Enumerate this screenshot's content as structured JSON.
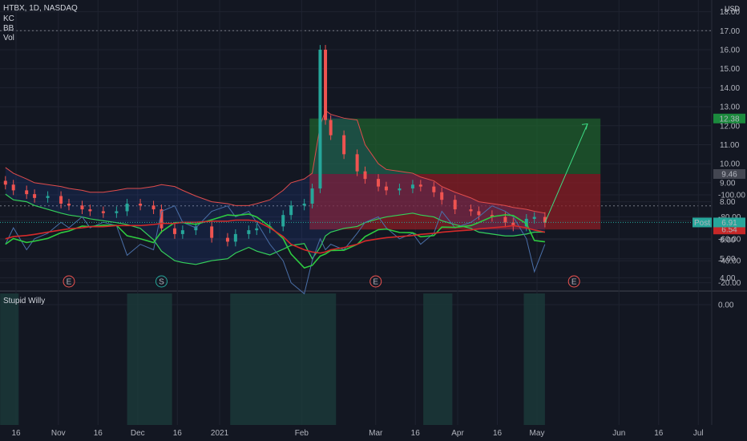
{
  "header": {
    "symbol_line": "HTBX, 1D, NASDAQ",
    "indicators": [
      "KC",
      "BB",
      "Vol"
    ],
    "currency": "USD"
  },
  "oscillator": {
    "name": "Stupid Willy",
    "ticks": [
      "0.00",
      "-20.00",
      "-40.00",
      "-60.00",
      "-80.00",
      "-100.00"
    ]
  },
  "price_ticks": [
    "4.00",
    "5.00",
    "6.00",
    "7.00",
    "8.00",
    "9.00",
    "10.00",
    "11.00",
    "12.00",
    "13.00",
    "14.00",
    "15.00",
    "16.00",
    "17.00",
    "18.00"
  ],
  "badges": {
    "target": "12.38",
    "entry": "9.46",
    "post_label": "Post",
    "post_value": "6.91",
    "last": "6.74",
    "stop": "6.54"
  },
  "events": [
    "E",
    "S",
    "E",
    "E"
  ],
  "x_ticks": [
    "16",
    "Nov",
    "16",
    "Dec",
    "16",
    "2021",
    "Feb",
    "Mar",
    "16",
    "Apr",
    "16",
    "May",
    "Jun",
    "16",
    "Jul"
  ],
  "colors": {
    "bg": "#131722",
    "up": "#26a69a",
    "down": "#ef5350",
    "target_zone": "#1f5f2c",
    "stop_zone": "#8b1e24",
    "bb_upper": "#e04c4c",
    "bb_lower": "#35d05a",
    "osc_line": "#4a6fa8",
    "osc_fast": "#2ecc40",
    "osc_slow": "#d42a2a",
    "highlight": "#1b3b3b"
  },
  "chart_data": {
    "type": "candlestick",
    "x": [
      "2020-10-12",
      "2020-10-15",
      "2020-10-20",
      "2020-10-23",
      "2020-10-28",
      "2020-11-02",
      "2020-11-05",
      "2020-11-10",
      "2020-11-13",
      "2020-11-18",
      "2020-11-23",
      "2020-11-27",
      "2020-12-02",
      "2020-12-07",
      "2020-12-10",
      "2020-12-15",
      "2020-12-18",
      "2020-12-23",
      "2020-12-29",
      "2021-01-04",
      "2021-01-07",
      "2021-01-12",
      "2021-01-15",
      "2021-01-20",
      "2021-01-25",
      "2021-01-28",
      "2021-02-02",
      "2021-02-05",
      "2021-02-08",
      "2021-02-10",
      "2021-02-12",
      "2021-02-17",
      "2021-02-22",
      "2021-02-25",
      "2021-03-02",
      "2021-03-05",
      "2021-03-10",
      "2021-03-15",
      "2021-03-18",
      "2021-03-23",
      "2021-03-26",
      "2021-03-31",
      "2021-04-06",
      "2021-04-09",
      "2021-04-14",
      "2021-04-19",
      "2021-04-22",
      "2021-04-27",
      "2021-04-30",
      "2021-05-04"
    ],
    "close": [
      8.9,
      8.6,
      8.4,
      8.2,
      8.3,
      7.9,
      7.8,
      7.6,
      7.5,
      7.4,
      7.5,
      7.9,
      7.8,
      7.6,
      6.6,
      6.3,
      6.5,
      6.7,
      6.1,
      5.9,
      6.3,
      6.5,
      6.6,
      6.7,
      7.3,
      7.8,
      7.9,
      8.7,
      16.0,
      12.3,
      11.5,
      10.5,
      9.6,
      9.2,
      8.8,
      8.6,
      8.7,
      8.9,
      8.8,
      8.5,
      8.1,
      7.6,
      7.5,
      7.3,
      7.2,
      6.9,
      6.7,
      7.1,
      7.2,
      6.9
    ],
    "bb_upper": [
      9.8,
      9.5,
      9.2,
      9.0,
      8.9,
      8.8,
      8.7,
      8.6,
      8.5,
      8.5,
      8.6,
      8.7,
      8.7,
      8.8,
      8.9,
      8.8,
      8.6,
      8.3,
      8.0,
      7.9,
      7.8,
      7.8,
      7.9,
      8.1,
      8.6,
      9.0,
      9.2,
      9.5,
      12.0,
      12.8,
      12.6,
      12.4,
      12.3,
      11.0,
      10.0,
      9.7,
      9.6,
      9.5,
      9.3,
      9.1,
      8.8,
      8.5,
      8.2,
      8.0,
      7.9,
      7.8,
      7.7,
      7.6,
      7.5,
      7.4
    ],
    "bb_lower": [
      8.4,
      8.1,
      8.0,
      7.8,
      7.6,
      7.4,
      7.3,
      7.2,
      7.1,
      7.0,
      6.9,
      6.8,
      6.6,
      6.0,
      5.4,
      4.9,
      4.8,
      4.7,
      4.9,
      5.0,
      5.3,
      5.6,
      5.4,
      5.2,
      5.5,
      5.7,
      5.8,
      5.0,
      5.6,
      6.2,
      6.4,
      6.6,
      6.7,
      6.9,
      7.1,
      7.2,
      7.3,
      7.4,
      7.3,
      7.2,
      7.0,
      6.8,
      6.6,
      6.4,
      6.3,
      6.2,
      6.2,
      6.3,
      6.4,
      6.4
    ],
    "oscillator": [
      -55,
      -70,
      -50,
      -60,
      -65,
      -75,
      -70,
      -80,
      -70,
      -75,
      -72,
      -45,
      -55,
      -50,
      -85,
      -90,
      -75,
      -70,
      -85,
      -90,
      -80,
      -85,
      -75,
      -55,
      -40,
      -20,
      -10,
      -40,
      -60,
      -50,
      -55,
      -50,
      -65,
      -75,
      -80,
      -70,
      -60,
      -65,
      -55,
      -65,
      -85,
      -70,
      -75,
      -80,
      -90,
      -85,
      -80,
      -60,
      -30,
      -55
    ],
    "osc_slow": [
      -60,
      -62,
      -63,
      -64,
      -66,
      -68,
      -69,
      -70,
      -71,
      -71,
      -72,
      -72,
      -72,
      -73,
      -74,
      -74,
      -75,
      -75,
      -76,
      -76,
      -77,
      -77,
      -76,
      -70,
      -62,
      -55,
      -50,
      -48,
      -47,
      -48,
      -50,
      -52,
      -55,
      -58,
      -60,
      -61,
      -62,
      -63,
      -64,
      -65,
      -66,
      -67,
      -68,
      -69,
      -70,
      -71,
      -72,
      -70,
      -68,
      -66
    ],
    "trade": {
      "entry": 9.46,
      "target": 12.38,
      "stop": 6.54,
      "start": "2021-02-04",
      "end": "2021-05-25"
    }
  }
}
